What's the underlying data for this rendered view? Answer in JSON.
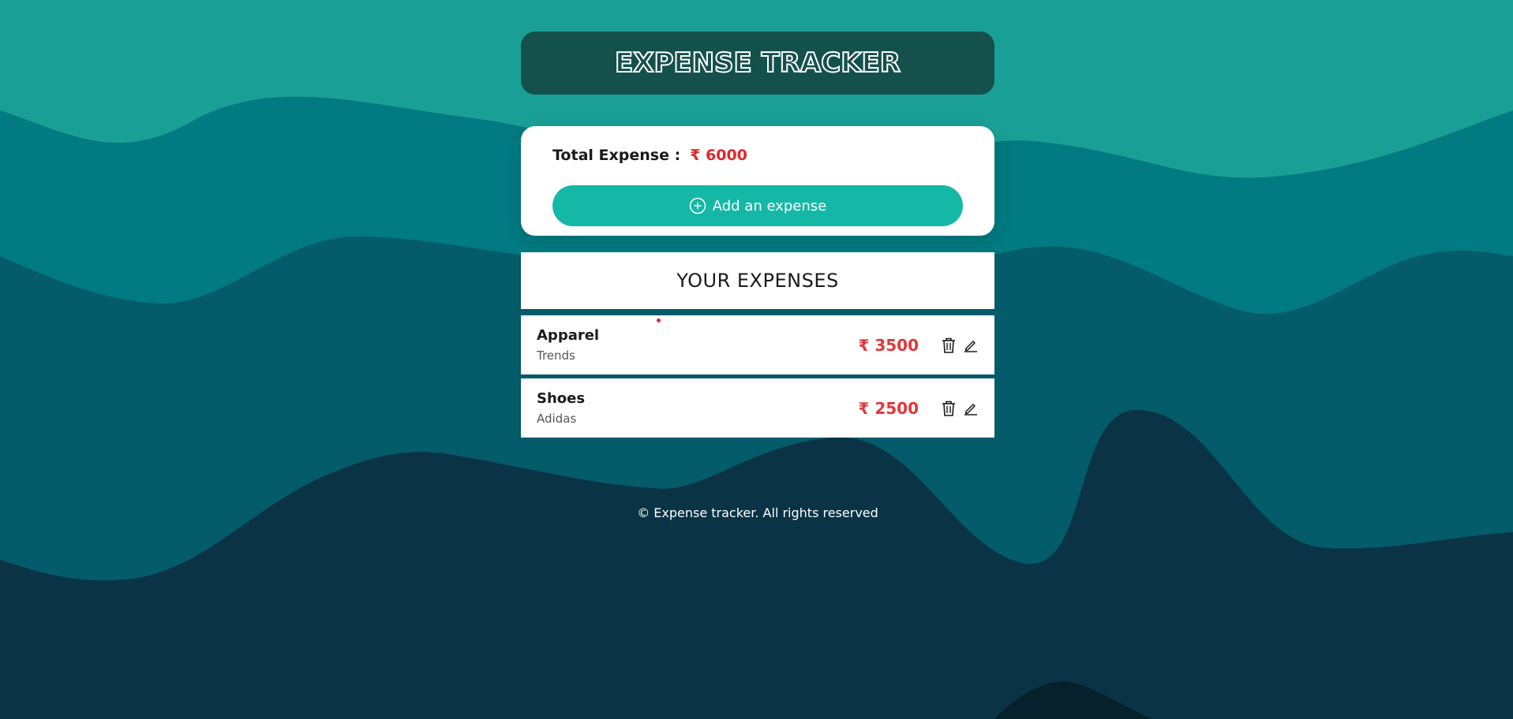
{
  "app": {
    "title": "EXPENSE TRACKER"
  },
  "summary": {
    "total_label": "Total Expense :",
    "total_value": "₹ 6000",
    "add_button_label": "Add an expense"
  },
  "expenses": {
    "header": "YOUR EXPENSES",
    "items": [
      {
        "name": "Apparel",
        "vendor": "Trends",
        "amount": "₹ 3500"
      },
      {
        "name": "Shoes",
        "vendor": "Adidas",
        "amount": "₹ 2500"
      }
    ]
  },
  "footer": {
    "text": "© Expense tracker. All rights reserved"
  },
  "colors": {
    "accent": "#15b8a6",
    "header_bg": "#14504c",
    "amount": "#e3262a",
    "wave_1": "#1a9f97",
    "wave_2": "#017a82",
    "wave_3": "#045b6a",
    "wave_4": "#0a3345",
    "wave_5": "#06202c"
  },
  "icons": {
    "add": "plus-circle-icon",
    "delete": "trash-icon",
    "edit": "pencil-icon"
  }
}
